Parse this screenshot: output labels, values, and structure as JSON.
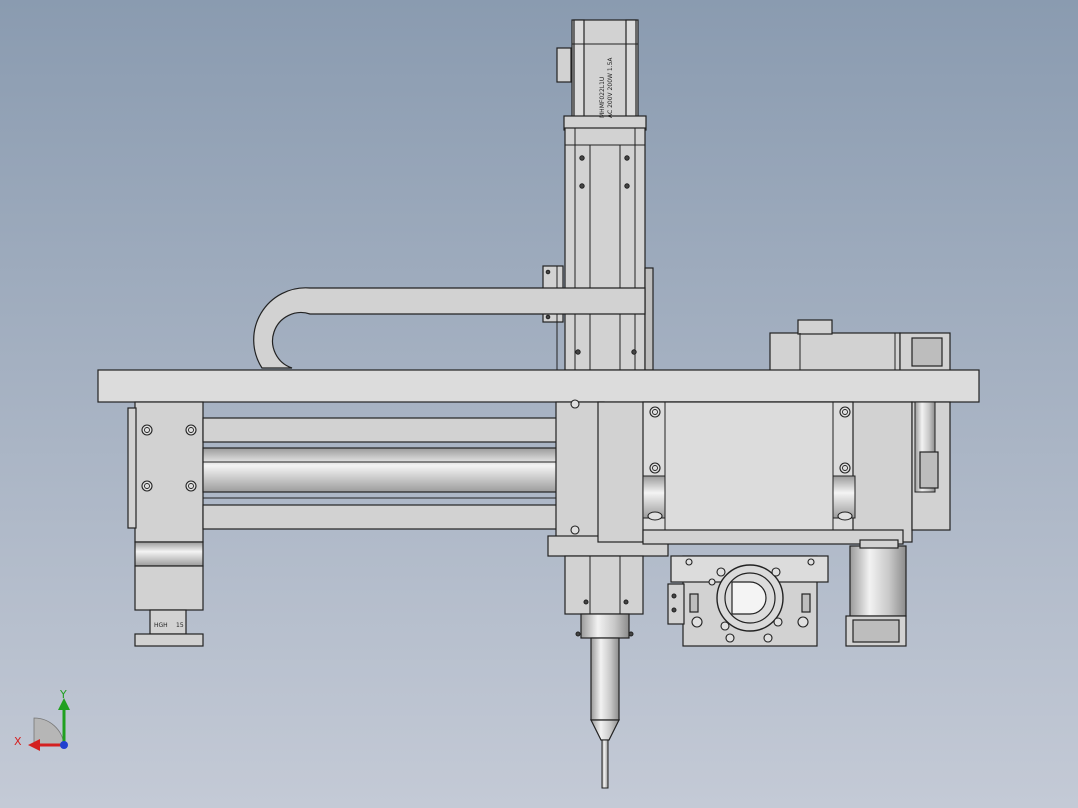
{
  "viewport": {
    "background_top": "#8a9bb0",
    "background_bottom": "#c4cad6"
  },
  "motor_labels": {
    "vertical_motor_line1": "MHMF022L1U",
    "vertical_motor_line2": "AC 200V 200W 1.5A",
    "rail_block_left": "HGH",
    "rail_block_right": "15"
  },
  "triad": {
    "x_label": "X",
    "y_label": "Y",
    "x_color": "#d42020",
    "y_color": "#20a020",
    "z_color": "#2040d0"
  }
}
